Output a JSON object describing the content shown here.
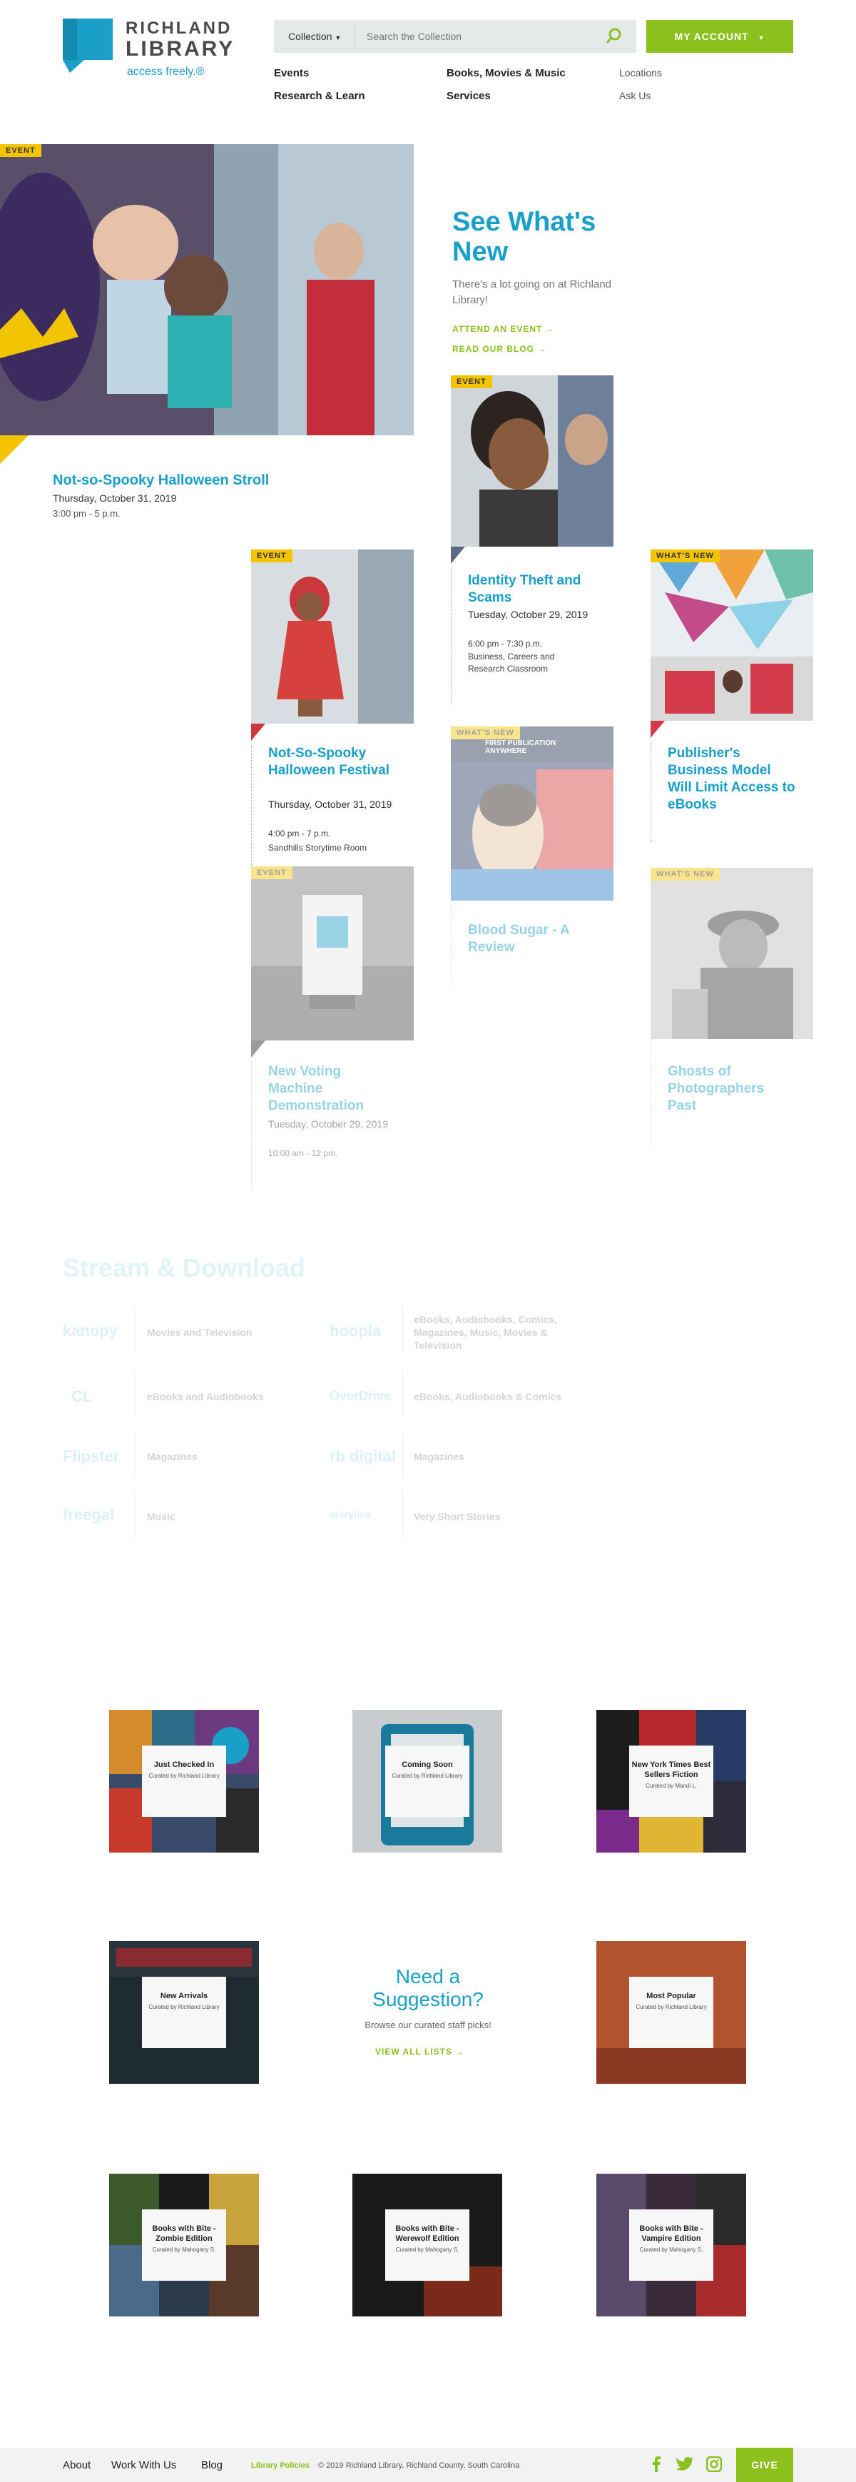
{
  "header": {
    "logo_line1": "RICHLAND",
    "logo_line2": "LIBRARY",
    "logo_tagline": "access freely.®",
    "search_scope": "Collection",
    "search_placeholder": "Search the Collection",
    "account_label": "MY ACCOUNT",
    "nav": {
      "events": "Events",
      "books": "Books, Movies & Music",
      "locations": "Locations",
      "research": "Research & Learn",
      "services": "Services",
      "ask": "Ask Us"
    }
  },
  "hero": {
    "badge": "EVENT",
    "title": "Not-so-Spooky Halloween Stroll",
    "date": "Thursday, October 31, 2019",
    "time": "3:00 pm - 5 p.m."
  },
  "whats_new": {
    "title": "See What's New",
    "desc": "There's a lot going on at Richland Library!",
    "attend": "ATTEND AN EVENT →",
    "blog": "READ OUR BLOG →"
  },
  "cards": {
    "identity": {
      "badge": "EVENT",
      "title": "Identity Theft and Scams",
      "date": "Tuesday, October 29, 2019",
      "time": "6:00 pm - 7:30 p.m.",
      "place": "Business, Careers and Research Classroom"
    },
    "festival": {
      "badge": "EVENT",
      "title": "Not-So-Spooky Halloween Festival",
      "date": "Thursday, October 31, 2019",
      "time": "4:00 pm - 7 p.m.",
      "place": "Sandhills Storytime Room"
    },
    "publisher": {
      "badge": "WHAT'S NEW",
      "title": "Publisher's Business Model Will Limit Access to eBooks"
    },
    "blood": {
      "badge": "WHAT'S NEW",
      "cover_text": "FIRST PUBLICATION ANYWHERE",
      "title": "Blood Sugar - A Review"
    },
    "voting": {
      "badge": "EVENT",
      "title": "New Voting Machine Demonstration",
      "date": "Tuesday, October 29, 2019",
      "time": "10:00 am - 12 pm."
    },
    "ghosts": {
      "badge": "WHAT'S NEW",
      "title": "Ghosts of Photographers Past"
    }
  },
  "stream": {
    "title": "Stream & Download",
    "services": [
      {
        "logo": "kanopy",
        "desc": "Movies and Television"
      },
      {
        "logo": "hoopla",
        "desc": "eBooks, Audiobooks, Comics, Magazines, Music, Movies & Television"
      },
      {
        "logo": "CL",
        "desc": "eBooks and Audiobooks"
      },
      {
        "logo": "OverDrive",
        "desc": "eBooks, Audiobooks & Comics"
      },
      {
        "logo": "Flipster",
        "desc": "Magazines"
      },
      {
        "logo": "rb digital",
        "desc": "Magazines"
      },
      {
        "logo": "freegal",
        "desc": "Music"
      },
      {
        "logo": "storyline",
        "desc": "Very Short Stories"
      }
    ]
  },
  "lists": {
    "tiles": [
      {
        "title": "Just Checked In",
        "sub": "Curated by Richland Library"
      },
      {
        "title": "Coming Soon",
        "sub": "Curated by Richland Library"
      },
      {
        "title": "New York Times Best Sellers Fiction",
        "sub": "Curated by Mandi L."
      },
      {
        "title": "New Arrivals",
        "sub": "Curated by Richland Library"
      },
      {
        "title": "Most Popular",
        "sub": "Curated by Richland Library"
      },
      {
        "title": "Books with Bite - Zombie Edition",
        "sub": "Curated by Mahogany S."
      },
      {
        "title": "Books with Bite - Werewolf Edition",
        "sub": "Curated by Mahogany S."
      },
      {
        "title": "Books with Bite - Vampire Edition",
        "sub": "Curated by Mahogany S."
      }
    ],
    "suggest_title": "Need a Suggestion?",
    "suggest_desc": "Browse our curated staff picks!",
    "suggest_link": "VIEW ALL LISTS →"
  },
  "footer": {
    "about": "About",
    "work": "Work With Us",
    "blog": "Blog",
    "policies": "Library Policies",
    "copyright": "© 2019 Richland Library, Richland County, South Carolina",
    "give": "GIVE"
  },
  "colors": {
    "brand": "#1aa0c8",
    "accent": "#8ac11c",
    "badge": "#f4c400"
  }
}
